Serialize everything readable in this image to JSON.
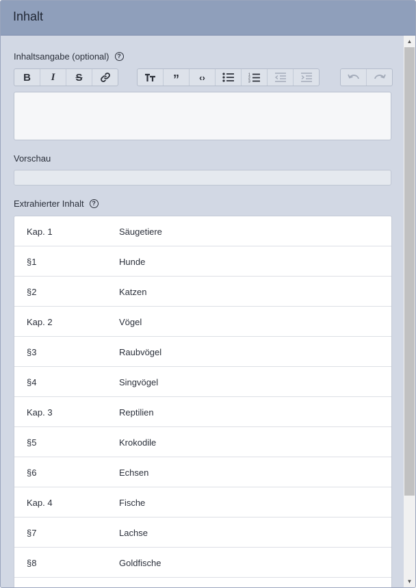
{
  "panel": {
    "title": "Inhalt"
  },
  "summary": {
    "label": "Inhaltsangabe (optional)",
    "help_icon": "question-circle-icon",
    "value": ""
  },
  "toolbar": {
    "groups": [
      [
        {
          "name": "bold",
          "icon": "bold-icon",
          "glyph": "B",
          "disabled": false
        },
        {
          "name": "italic",
          "icon": "italic-icon",
          "glyph": "I",
          "disabled": false
        },
        {
          "name": "strikethrough",
          "icon": "strikethrough-icon",
          "glyph": "S",
          "disabled": false
        },
        {
          "name": "link",
          "icon": "link-icon",
          "glyph": "",
          "disabled": false
        }
      ],
      [
        {
          "name": "heading",
          "icon": "heading-icon",
          "glyph": "T",
          "disabled": false
        },
        {
          "name": "quote",
          "icon": "quote-icon",
          "glyph": "❞",
          "disabled": false
        },
        {
          "name": "code",
          "icon": "code-icon",
          "glyph": "<>",
          "disabled": false
        },
        {
          "name": "bullet-list",
          "icon": "bullet-list-icon",
          "glyph": "",
          "disabled": false
        },
        {
          "name": "numbered-list",
          "icon": "numbered-list-icon",
          "glyph": "",
          "disabled": false
        },
        {
          "name": "outdent",
          "icon": "outdent-icon",
          "glyph": "",
          "disabled": true
        },
        {
          "name": "indent",
          "icon": "indent-icon",
          "glyph": "",
          "disabled": true
        }
      ],
      [
        {
          "name": "undo",
          "icon": "undo-icon",
          "glyph": "↶",
          "disabled": true
        },
        {
          "name": "redo",
          "icon": "redo-icon",
          "glyph": "↷",
          "disabled": true
        }
      ]
    ]
  },
  "preview": {
    "label": "Vorschau",
    "value": ""
  },
  "extracted": {
    "label": "Extrahierter Inhalt",
    "help_icon": "question-circle-icon",
    "rows": [
      {
        "key": "Kap. 1",
        "value": "Säugetiere"
      },
      {
        "key": "§1",
        "value": "Hunde"
      },
      {
        "key": "§2",
        "value": "Katzen"
      },
      {
        "key": "Kap. 2",
        "value": "Vögel"
      },
      {
        "key": "§3",
        "value": "Raubvögel"
      },
      {
        "key": "§4",
        "value": "Singvögel"
      },
      {
        "key": "Kap. 3",
        "value": "Reptilien"
      },
      {
        "key": "§5",
        "value": "Krokodile"
      },
      {
        "key": "§6",
        "value": "Echsen"
      },
      {
        "key": "Kap. 4",
        "value": "Fische"
      },
      {
        "key": "§7",
        "value": "Lachse"
      },
      {
        "key": "§8",
        "value": "Goldfische"
      },
      {
        "key": "",
        "value": ""
      }
    ]
  },
  "colors": {
    "header_bg": "#8f9fbb",
    "panel_bg": "#d2d8e4",
    "text": "#2a2f3a",
    "disabled": "#a3abb9"
  }
}
